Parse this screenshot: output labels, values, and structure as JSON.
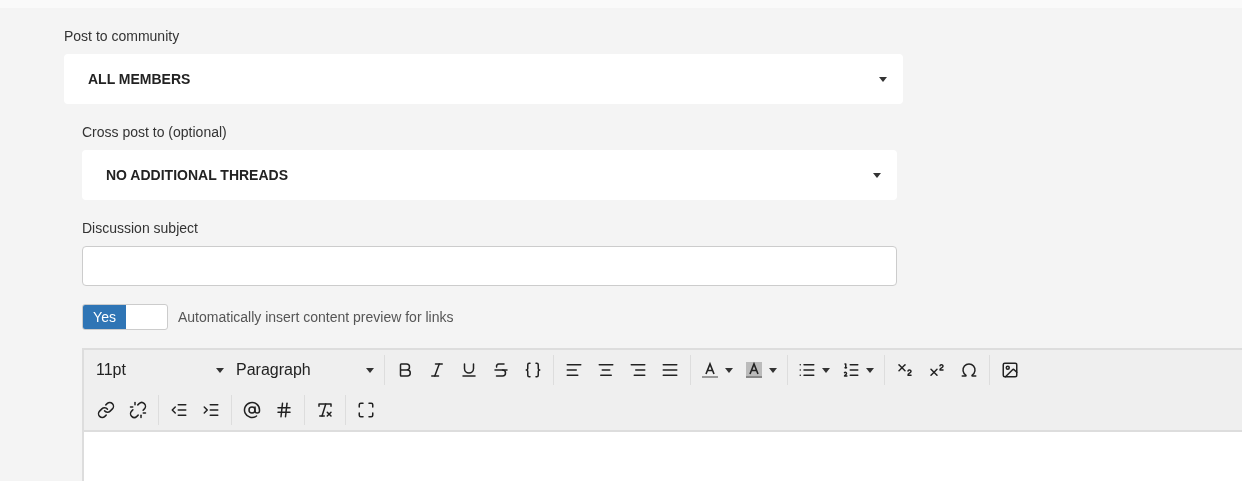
{
  "community": {
    "label": "Post to community",
    "value": "ALL MEMBERS"
  },
  "cross_post": {
    "label": "Cross post to (optional)",
    "value": "NO ADDITIONAL THREADS"
  },
  "subject": {
    "label": "Discussion subject"
  },
  "link_preview": {
    "toggle_label": "Yes",
    "on": true,
    "label": "Automatically insert content preview for links"
  },
  "editor": {
    "font_size": "11pt",
    "block_format": "Paragraph"
  }
}
